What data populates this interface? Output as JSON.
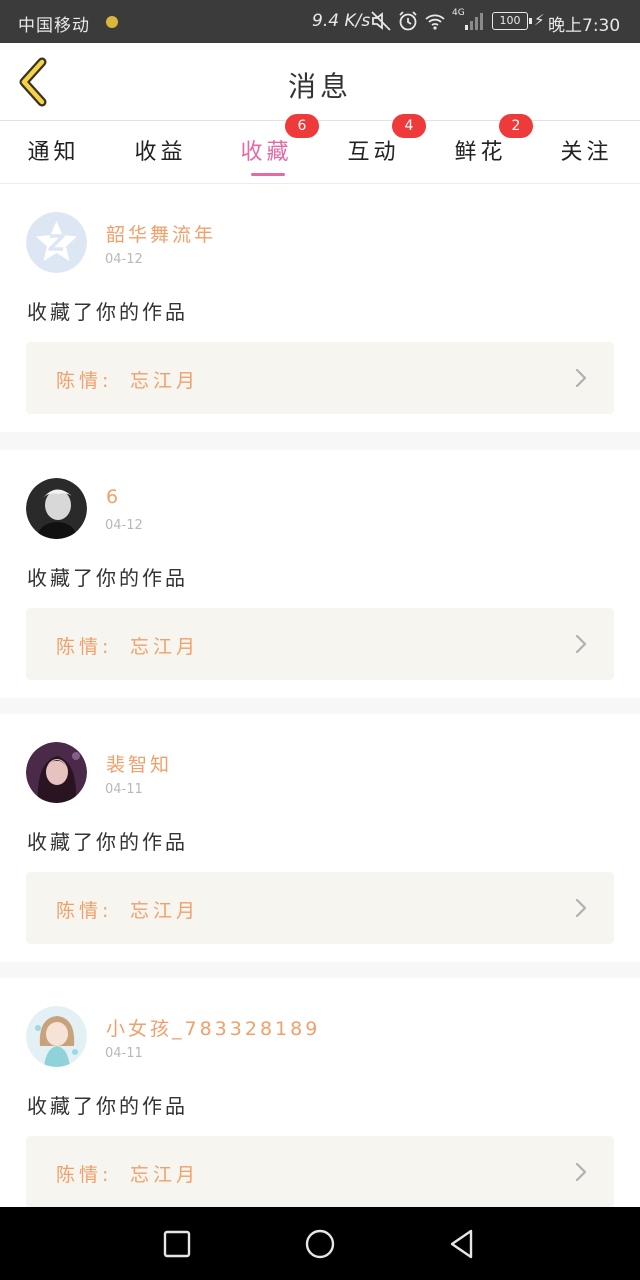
{
  "status_bar": {
    "carrier": "中国移动",
    "speed": "9.4 K/s",
    "network": "4G",
    "battery": "100",
    "time": "晚上7:30"
  },
  "header": {
    "title": "消息",
    "back_icon": "chevron-left-icon"
  },
  "tabs": [
    {
      "label": "通知",
      "badge": "",
      "active": false
    },
    {
      "label": "收益",
      "badge": "",
      "active": false
    },
    {
      "label": "收藏",
      "badge": "6",
      "active": true
    },
    {
      "label": "互动",
      "badge": "4",
      "active": false
    },
    {
      "label": "鲜花",
      "badge": "2",
      "active": false
    },
    {
      "label": "关注",
      "badge": "",
      "active": false
    }
  ],
  "feed": {
    "items": [
      {
        "username": "韶华舞流年",
        "date": "04-12",
        "action": "收藏了你的作品",
        "work_prefix": "陈情:",
        "work_title": "忘江月"
      },
      {
        "username": "6",
        "date": "04-12",
        "action": "收藏了你的作品",
        "work_prefix": "陈情:",
        "work_title": "忘江月"
      },
      {
        "username": "裴智知",
        "date": "04-11",
        "action": "收藏了你的作品",
        "work_prefix": "陈情:",
        "work_title": "忘江月"
      },
      {
        "username": "小女孩_783328189",
        "date": "04-11",
        "action": "收藏了你的作品",
        "work_prefix": "陈情:",
        "work_title": "忘江月"
      }
    ]
  },
  "colors": {
    "accent_pink": "#e36aa6",
    "badge_red": "#ee3a3a",
    "name_orange": "#f0a06b",
    "row_bg": "#f6f5ef"
  }
}
